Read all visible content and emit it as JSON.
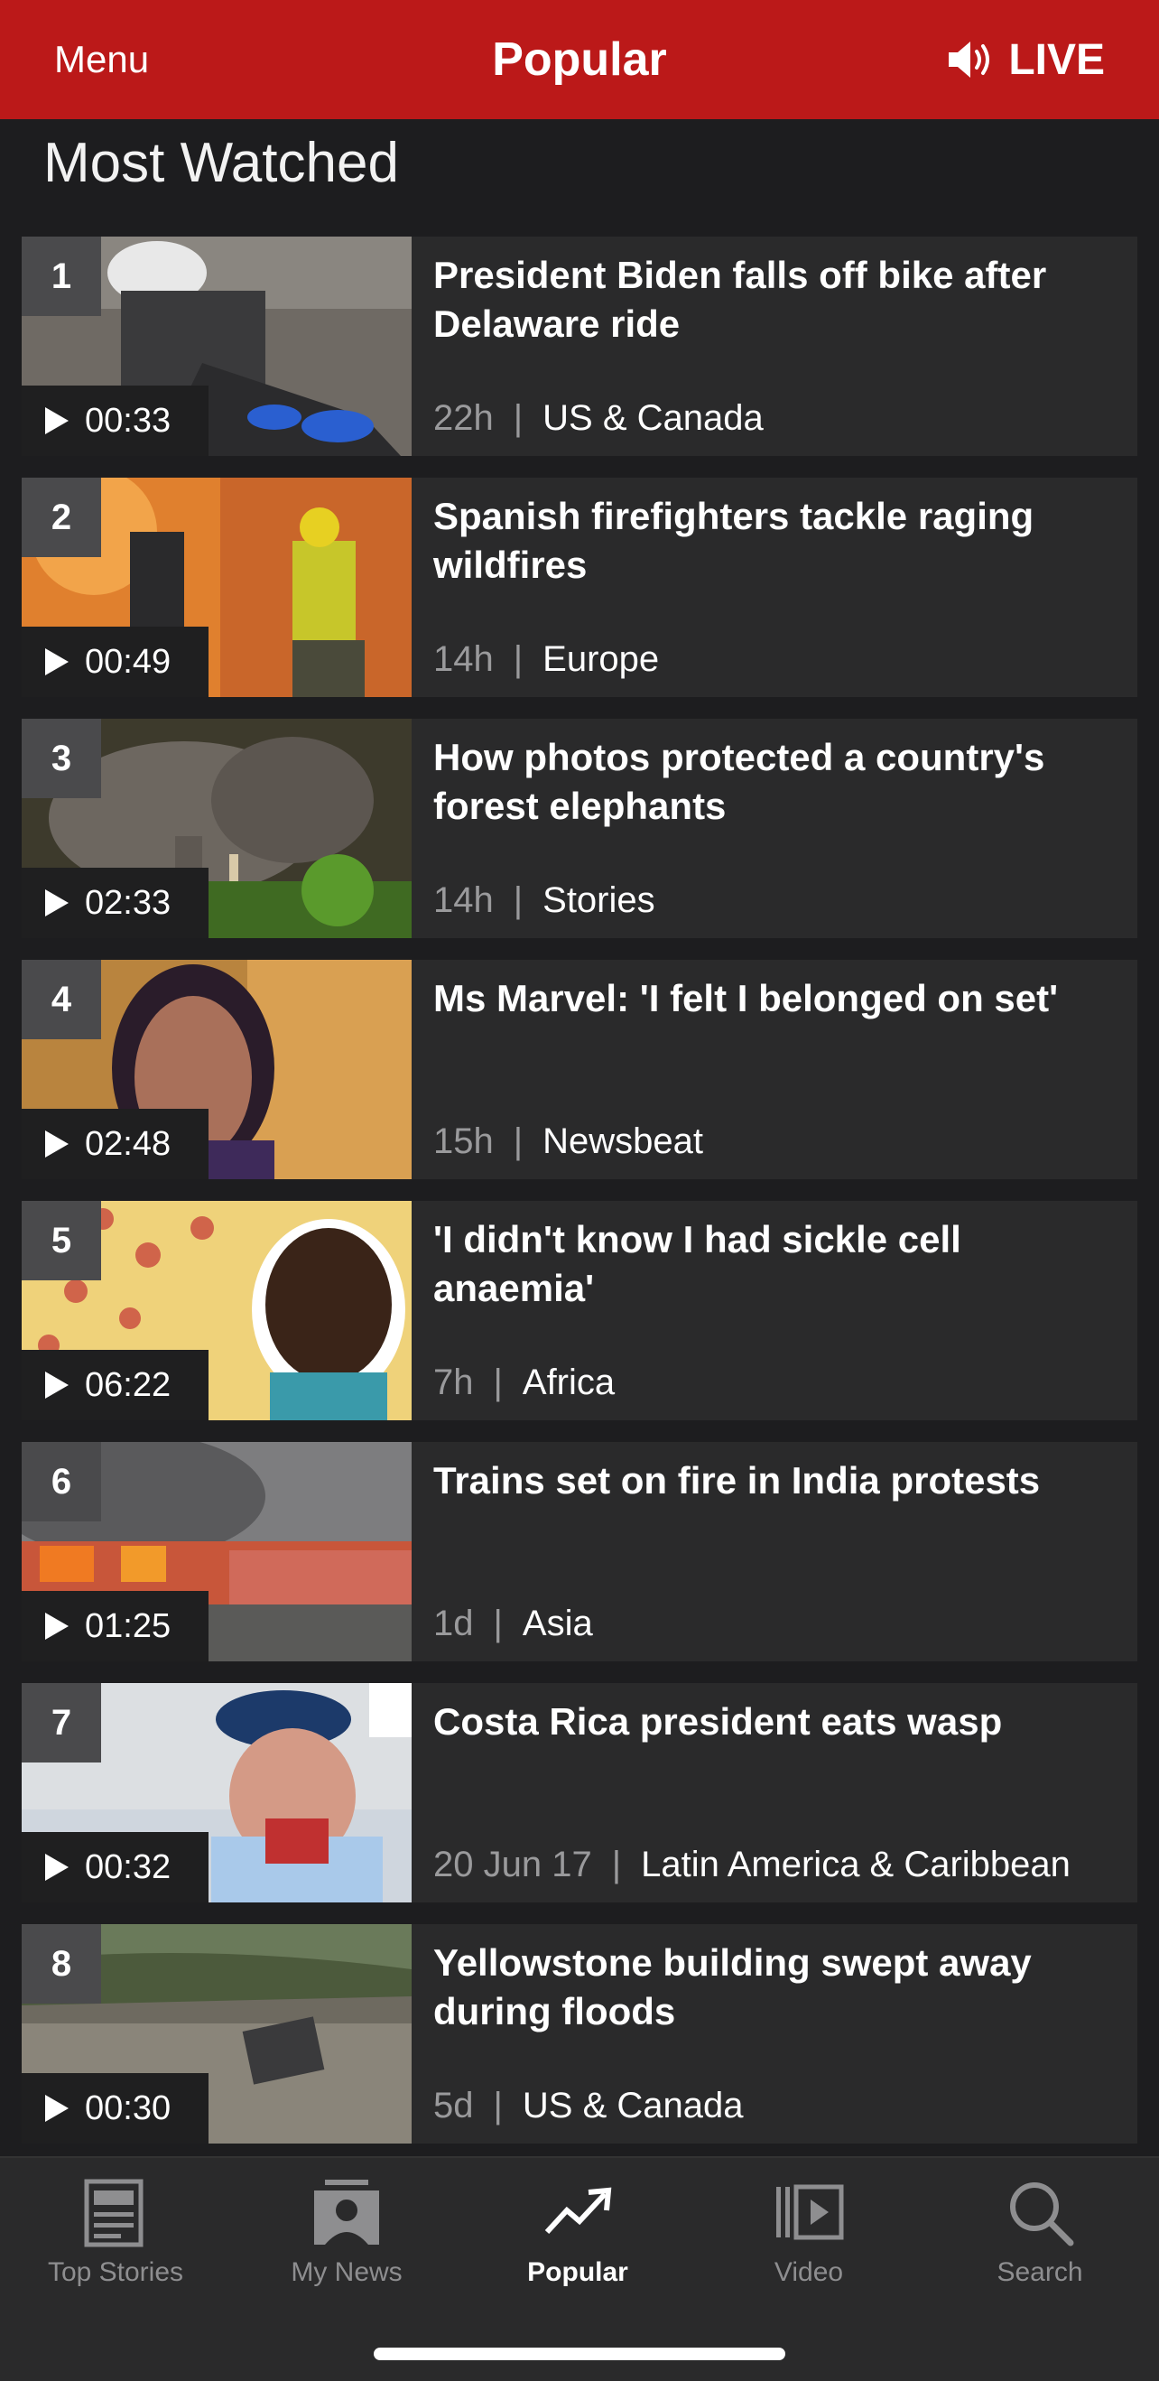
{
  "header": {
    "menu_label": "Menu",
    "title": "Popular",
    "live_label": "LIVE",
    "live_icon": "speaker-icon",
    "bg_color": "#bb1919"
  },
  "section": {
    "title": "Most Watched"
  },
  "items": [
    {
      "rank": "1",
      "duration": "00:33",
      "title": "President Biden falls off bike after Delaware ride",
      "age": "22h",
      "category": "US & Canada"
    },
    {
      "rank": "2",
      "duration": "00:49",
      "title": "Spanish firefighters tackle raging wildfires",
      "age": "14h",
      "category": "Europe"
    },
    {
      "rank": "3",
      "duration": "02:33",
      "title": "How photos protected a country's forest elephants",
      "age": "14h",
      "category": "Stories"
    },
    {
      "rank": "4",
      "duration": "02:48",
      "title": "Ms Marvel: 'I felt I belonged on set'",
      "age": "15h",
      "category": "Newsbeat"
    },
    {
      "rank": "5",
      "duration": "06:22",
      "title": "'I didn't know I had sickle cell anaemia'",
      "age": "7h",
      "category": "Africa"
    },
    {
      "rank": "6",
      "duration": "01:25",
      "title": "Trains set on fire in India protests",
      "age": "1d",
      "category": "Asia"
    },
    {
      "rank": "7",
      "duration": "00:32",
      "title": "Costa Rica president eats wasp",
      "age": "20 Jun 17",
      "category": "Latin America & Caribbean"
    },
    {
      "rank": "8",
      "duration": "00:30",
      "title": "Yellowstone building swept away during floods",
      "age": "5d",
      "category": "US & Canada"
    }
  ],
  "separator": "|",
  "tabbar": {
    "tabs": [
      {
        "label": "Top Stories",
        "icon": "newspaper-icon"
      },
      {
        "label": "My News",
        "icon": "person-card-icon"
      },
      {
        "label": "Popular",
        "icon": "trending-icon",
        "active": true
      },
      {
        "label": "Video",
        "icon": "video-icon"
      },
      {
        "label": "Search",
        "icon": "search-icon"
      }
    ]
  }
}
